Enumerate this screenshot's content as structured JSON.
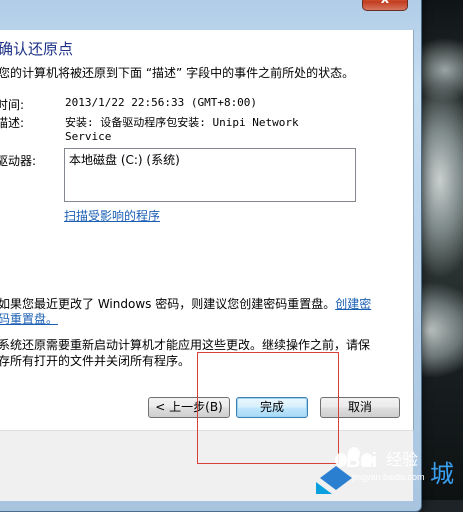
{
  "dialog": {
    "close_label": "x",
    "title": "确认还原点",
    "subtitle": "您的计算机将被还原到下面 “描述” 字段中的事件之前所处的状态。",
    "time_label": "时间:",
    "time_value": "2013/1/22 22:56:33 (GMT+8:00)",
    "desc_label": "描述:",
    "desc_value_line1": "安装: 设备驱动程序包安装: Unipi Network",
    "desc_value_line2": "Service",
    "drives_label": "驱动器:",
    "drive_item": "本地磁盘 (C:) (系统)",
    "scan_link": "扫描受影响的程序",
    "password_note": "如果您最近更改了 Windows 密码，则建议您创建密码重置盘。",
    "password_link_part1": "创建密",
    "password_link_part2": "码重置盘。",
    "warning_line1": "系统还原需要重新启动计算机才能应用这些更改。继续操作之前，请保",
    "warning_line2": "存所有打开的文件并关闭所有程序。",
    "back_button": "< 上一步(B)",
    "finish_button": "完成",
    "cancel_button": "取消"
  },
  "watermark": {
    "logo_text": "Bai",
    "logo_text2": "经验",
    "sub_text": "jingyan.baidu.com",
    "site_char": "城"
  },
  "colors": {
    "title_color": "#1e3287",
    "link_color": "#1a5fb4",
    "highlight_box": "#d8403a"
  }
}
